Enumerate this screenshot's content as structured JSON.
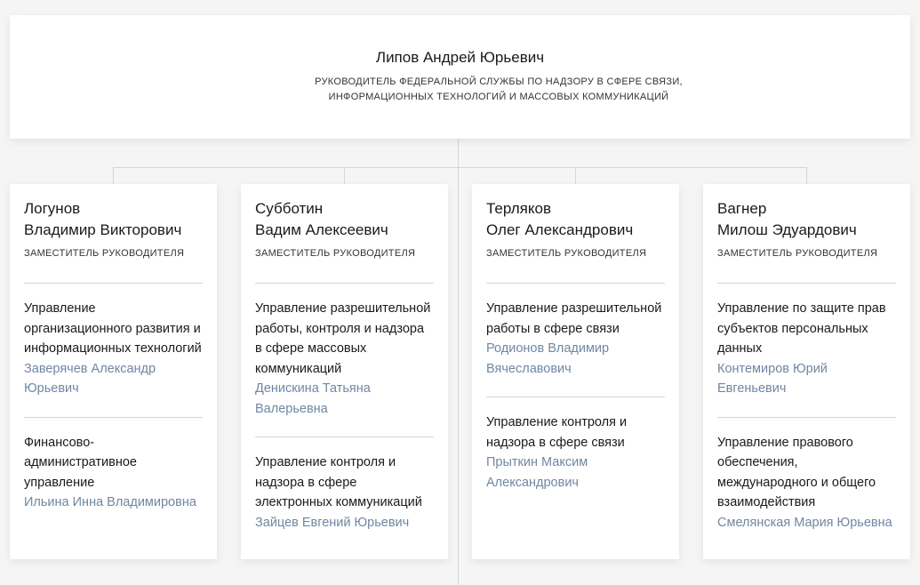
{
  "head": {
    "name": "Липов Андрей Юрьевич",
    "title": "Руководитель Федеральной службы по надзору в сфере связи, информационных технологий и массовых коммуникаций"
  },
  "deputies": [
    {
      "surname": "Логунов",
      "given": "Владимир Викторович",
      "role": "Заместитель руководителя",
      "units": [
        {
          "name": "Управление организационного развития и информационных технологий",
          "head": "Заверячев Александр Юрьевич"
        },
        {
          "name": "Финансово-административное управление",
          "head": "Ильина Инна Владимировна"
        }
      ]
    },
    {
      "surname": "Субботин",
      "given": "Вадим Алексеевич",
      "role": "Заместитель руководителя",
      "units": [
        {
          "name": "Управление разрешительной работы, контроля и надзора в сфере массовых коммуникаций",
          "head": "Денискина Татьяна Валерьевна"
        },
        {
          "name": "Управление контроля и надзора в сфере электронных коммуникаций",
          "head": "Зайцев Евгений Юрьевич"
        }
      ]
    },
    {
      "surname": "Терляков",
      "given": "Олег Александрович",
      "role": "Заместитель руководителя",
      "units": [
        {
          "name": "Управление разрешительной работы в сфере связи",
          "head": "Родионов Владимир Вячеславович"
        },
        {
          "name": "Управление контроля и надзора в сфере связи",
          "head": "Прыткин Максим Александрович"
        }
      ]
    },
    {
      "surname": "Вагнер",
      "given": "Милош Эдуардович",
      "role": "Заместитель руководителя",
      "units": [
        {
          "name": "Управление по защите прав субъектов персональных данных",
          "head": "Контемиров Юрий Евгеньевич"
        },
        {
          "name": "Управление правового обеспечения, международного и общего взаимодействия",
          "head": "Смелянская Мария Юрьевна"
        }
      ]
    }
  ]
}
